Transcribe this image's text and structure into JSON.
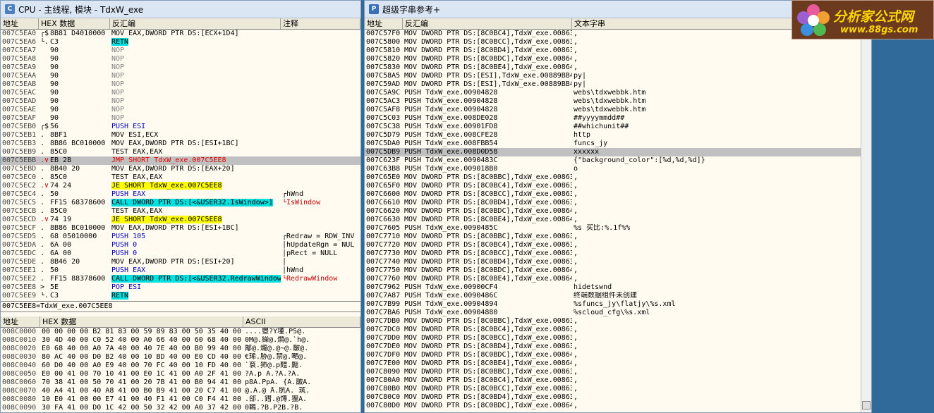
{
  "cpu_window": {
    "title": "CPU - 主线程, 模块 - TdxW_exe",
    "headers": {
      "addr": "地址",
      "hex": "HEX 数据",
      "asm": "反汇编",
      "cmt": "注释"
    },
    "rows": [
      {
        "a": "007C5EA0",
        "m": "┌$",
        "h": "8B81 D4010000",
        "i": "MOV EAX,DWORD PTR DS:[ECX+1D4]",
        "c": "",
        "k": ""
      },
      {
        "a": "007C5EA6",
        "m": "└.",
        "h": "C3",
        "i": "RETN",
        "c": "",
        "k": "ret"
      },
      {
        "a": "007C5EA7",
        "m": "",
        "h": "90",
        "i": "NOP",
        "c": "",
        "k": "nop"
      },
      {
        "a": "007C5EA8",
        "m": "",
        "h": "90",
        "i": "NOP",
        "c": "",
        "k": "nop"
      },
      {
        "a": "007C5EA9",
        "m": "",
        "h": "90",
        "i": "NOP",
        "c": "",
        "k": "nop"
      },
      {
        "a": "007C5EAA",
        "m": "",
        "h": "90",
        "i": "NOP",
        "c": "",
        "k": "nop"
      },
      {
        "a": "007C5EAB",
        "m": "",
        "h": "90",
        "i": "NOP",
        "c": "",
        "k": "nop"
      },
      {
        "a": "007C5EAC",
        "m": "",
        "h": "90",
        "i": "NOP",
        "c": "",
        "k": "nop"
      },
      {
        "a": "007C5EAD",
        "m": "",
        "h": "90",
        "i": "NOP",
        "c": "",
        "k": "nop"
      },
      {
        "a": "007C5EAE",
        "m": "",
        "h": "90",
        "i": "NOP",
        "c": "",
        "k": "nop"
      },
      {
        "a": "007C5EAF",
        "m": "",
        "h": "90",
        "i": "NOP",
        "c": "",
        "k": "nop"
      },
      {
        "a": "007C5EB0",
        "m": "┌$",
        "h": "56",
        "i": "PUSH ESI",
        "c": "",
        "k": "push"
      },
      {
        "a": "007C5EB1",
        "m": ".",
        "h": "8BF1",
        "i": "MOV ESI,ECX",
        "c": "",
        "k": ""
      },
      {
        "a": "007C5EB3",
        "m": ".",
        "h": "8B86 BC010000",
        "i": "MOV EAX,DWORD PTR DS:[ESI+1BC]",
        "c": "",
        "k": ""
      },
      {
        "a": "007C5EB9",
        "m": ".",
        "h": "85C0",
        "i": "TEST EAX,EAX",
        "c": "",
        "k": ""
      },
      {
        "a": "007C5EBB",
        "m": ".∨",
        "h": "EB 2B",
        "i": "JMP SHORT TdxW_exe.007C5EE8",
        "c": "",
        "k": "jmp",
        "sel": true
      },
      {
        "a": "007C5EBD",
        "m": ".",
        "h": "8B40 20",
        "i": "MOV EAX,DWORD PTR DS:[EAX+20]",
        "c": "",
        "k": ""
      },
      {
        "a": "007C5EC0",
        "m": ".",
        "h": "85C0",
        "i": "TEST EAX,EAX",
        "c": "",
        "k": ""
      },
      {
        "a": "007C5EC2",
        "m": ".∨",
        "h": "74 24",
        "i": "JE SHORT TdxW_exe.007C5EE8",
        "c": "",
        "k": "je"
      },
      {
        "a": "007C5EC4",
        "m": ".",
        "h": "50",
        "i": "PUSH EAX",
        "c": "┌hWnd",
        "k": "push"
      },
      {
        "a": "007C5EC5",
        "m": ".",
        "h": "FF15 68378600",
        "i": "CALL DWORD PTR DS:[<&USER32.IsWindow>]",
        "c": "└IsWindow",
        "k": "call",
        "cr": true
      },
      {
        "a": "007C5ECB",
        "m": ".",
        "h": "85C0",
        "i": "TEST EAX,EAX",
        "c": "",
        "k": ""
      },
      {
        "a": "007C5ECD",
        "m": ".∨",
        "h": "74 19",
        "i": "JE SHORT TdxW_exe.007C5EE8",
        "c": "",
        "k": "je"
      },
      {
        "a": "007C5ECF",
        "m": ".",
        "h": "8B86 BC010000",
        "i": "MOV EAX,DWORD PTR DS:[ESI+1BC]",
        "c": "",
        "k": ""
      },
      {
        "a": "007C5ED5",
        "m": ".",
        "h": "68 05010000",
        "i": "PUSH 105",
        "c": "┌Redraw = RDW_INV",
        "k": "push"
      },
      {
        "a": "007C5EDA",
        "m": ".",
        "h": "6A 00",
        "i": "PUSH 0",
        "c": "│hUpdateRgn = NUL",
        "k": "push"
      },
      {
        "a": "007C5EDC",
        "m": ".",
        "h": "6A 00",
        "i": "PUSH 0",
        "c": "│pRect = NULL",
        "k": "push"
      },
      {
        "a": "007C5EDE",
        "m": ".",
        "h": "8B46 20",
        "i": "MOV EAX,DWORD PTR DS:[ESI+20]",
        "c": "│",
        "k": ""
      },
      {
        "a": "007C5EE1",
        "m": ".",
        "h": "50",
        "i": "PUSH EAX",
        "c": "│hWnd",
        "k": "push"
      },
      {
        "a": "007C5EE2",
        "m": ".",
        "h": "FF15 88378600",
        "i": "CALL DWORD PTR DS:[<&USER32.RedrawWindow>]",
        "c": "└RedrawWindow",
        "k": "call",
        "cr": true
      },
      {
        "a": "007C5EE8",
        "m": "> 5E",
        "h": "5E",
        "i": "POP ESI",
        "c": "",
        "k": "push"
      },
      {
        "a": "007C5EE9",
        "m": "└.",
        "h": "C3",
        "i": "RETN",
        "c": "",
        "k": "ret"
      }
    ],
    "info": "007C5EE8=TdxW_exe.007C5EE8",
    "dump_headers": {
      "addr": "地址",
      "hex": "HEX 数据",
      "ascii": "ASCII"
    },
    "dump": [
      {
        "a": "008C0000",
        "h": "00 00 00 00 B2 81 83 00 59 89 83 00 50 35 40 00",
        "t": "....瞾?Y墐.P5@."
      },
      {
        "a": "008C0010",
        "h": "30 4D 40 00 C0 52 40 00 A0 66 40 00 60 68 40 00",
        "t": "0M@.繰@.燜@.`h@."
      },
      {
        "a": "008C0020",
        "h": "E0 68 40 00 A0 7A 40 00 40 7E 40 00 B0 99 40 00",
        "t": "鄅@.爖@.@~@.皺@."
      },
      {
        "a": "008C0030",
        "h": "80 AC 40 00 D0 B2 40 00 10 BD 40 00 E0 CD 40 00",
        "t": "€琋.胁@.禁@.嗮@."
      },
      {
        "a": "008C0040",
        "h": "60 D0 40 00 A0 E9 40 00 70 FC 40 00 10 FD 40 00",
        "t": "`袬.犻@.p麷.齆."
      },
      {
        "a": "008C0050",
        "h": "E0 00 41 00 70 10 41 00 E0 1C 41 00 A0 2F 41 00",
        "t": "?A.p A.?A.?A."
      },
      {
        "a": "008C0060",
        "h": "70 38 41 00 50 70 41 00 20 7B 41 00 B0 94 41 00",
        "t": "p8A.PpA. {A.皵A."
      },
      {
        "a": "008C0070",
        "h": "40 A4 41 00 40 A8 41 00 B0 B9 41 00 20 C7 41 00",
        "t": "@.A.@ ̄A.肮A. 茿."
      },
      {
        "a": "008C0080",
        "h": "10 E0 41 00 00 E7 41 00 40 F1 41 00 C0 F4 41 00",
        "t": ".郃..鏏.@馎.狸A."
      },
      {
        "a": "008C0090",
        "h": "30 FA 41 00 D0 1C 42 00 50 32 42 00 A0 37 42 00",
        "t": "0鶤.?B.P2B.?B."
      }
    ]
  },
  "strings_window": {
    "title": "超级字串参考+",
    "headers": {
      "addr": "地址",
      "asm": "反汇编",
      "txt": "文本字串"
    },
    "rows": [
      {
        "a": "007C57F0",
        "i": "MOV DWORD PTR DS:[8C0BC4],TdxW_exe.00863",
        "t": ","
      },
      {
        "a": "007C5800",
        "i": "MOV DWORD PTR DS:[8C0BCC],TdxW_exe.00863",
        "t": ","
      },
      {
        "a": "007C5810",
        "i": "MOV DWORD PTR DS:[8C0BD4],TdxW_exe.00863",
        "t": ","
      },
      {
        "a": "007C5820",
        "i": "MOV DWORD PTR DS:[8C0BDC],TdxW_exe.00864",
        "t": ","
      },
      {
        "a": "007C5830",
        "i": "MOV DWORD PTR DS:[8C0BE4],TdxW_exe.00864",
        "t": ","
      },
      {
        "a": "007C58A5",
        "i": "MOV DWORD PTR DS:[ESI],TdxW_exe.00889BB4",
        "t": "py|"
      },
      {
        "a": "007C59AD",
        "i": "MOV DWORD PTR DS:[ESI],TdxW_exe.00889BB4",
        "t": "py|"
      },
      {
        "a": "007C5A9C",
        "i": "PUSH TdxW_exe.00904828",
        "t": "webs\\tdxwebbk.htm"
      },
      {
        "a": "007C5AC3",
        "i": "PUSH TdxW_exe.00904828",
        "t": "webs\\tdxwebbk.htm"
      },
      {
        "a": "007C5AF8",
        "i": "PUSH TdxW_exe.00904828",
        "t": "webs\\tdxwebbk.htm"
      },
      {
        "a": "007C5C03",
        "i": "PUSH TdxW_exe.008DE028",
        "t": "##yyyymmdd##"
      },
      {
        "a": "007C5C38",
        "i": "PUSH TdxW_exe.00901FD8",
        "t": "##whichunit##"
      },
      {
        "a": "007C5D79",
        "i": "PUSH TdxW_exe.008CFE28",
        "t": "http"
      },
      {
        "a": "007C5DA0",
        "i": "PUSH TdxW_exe.008FBB54",
        "t": "funcs_jy"
      },
      {
        "a": "007C5DB9",
        "i": "PUSH TdxW_exe.008D0D58",
        "t": "xxxxxx",
        "sel": true
      },
      {
        "a": "007C623F",
        "i": "PUSH TdxW_exe.0090483C",
        "t": "{\"background_color\":[%d,%d,%d]}"
      },
      {
        "a": "007C63B8",
        "i": "PUSH TdxW_exe.009018B0",
        "t": "o"
      },
      {
        "a": "007C65E0",
        "i": "MOV DWORD PTR DS:[8C0BBC],TdxW_exe.00863",
        "t": ","
      },
      {
        "a": "007C65F0",
        "i": "MOV DWORD PTR DS:[8C0BC4],TdxW_exe.00863",
        "t": ","
      },
      {
        "a": "007C6600",
        "i": "MOV DWORD PTR DS:[8C0BCC],TdxW_exe.00863",
        "t": ","
      },
      {
        "a": "007C6610",
        "i": "MOV DWORD PTR DS:[8C0BD4],TdxW_exe.00863",
        "t": ","
      },
      {
        "a": "007C6620",
        "i": "MOV DWORD PTR DS:[8C0BDC],TdxW_exe.00864",
        "t": ","
      },
      {
        "a": "007C6630",
        "i": "MOV DWORD PTR DS:[8C0BE4],TdxW_exe.00864",
        "t": ","
      },
      {
        "a": "007C7605",
        "i": "PUSH TdxW_exe.0090485C",
        "t": "%s 买比:%.1f%%"
      },
      {
        "a": "007C7710",
        "i": "MOV DWORD PTR DS:[8C0BBC],TdxW_exe.00863",
        "t": ","
      },
      {
        "a": "007C7720",
        "i": "MOV DWORD PTR DS:[8C0BC4],TdxW_exe.00863",
        "t": ","
      },
      {
        "a": "007C7730",
        "i": "MOV DWORD PTR DS:[8C0BCC],TdxW_exe.00863",
        "t": ","
      },
      {
        "a": "007C7740",
        "i": "MOV DWORD PTR DS:[8C0BD4],TdxW_exe.00863",
        "t": ","
      },
      {
        "a": "007C7750",
        "i": "MOV DWORD PTR DS:[8C0BDC],TdxW_exe.00864",
        "t": ","
      },
      {
        "a": "007C7760",
        "i": "MOV DWORD PTR DS:[8C0BE4],TdxW_exe.00864",
        "t": ","
      },
      {
        "a": "007C7962",
        "i": "PUSH TdxW_exe.00900CF4",
        "t": "hidetswnd"
      },
      {
        "a": "007C7A87",
        "i": "PUSH TdxW_exe.0090486C",
        "t": "终端数据组件未创建"
      },
      {
        "a": "007C7B99",
        "i": "PUSH TdxW_exe.00904894",
        "t": "%sfuncs_jy\\flatjy\\%s.xml"
      },
      {
        "a": "007C7BA6",
        "i": "PUSH TdxW_exe.00904880",
        "t": "%scloud_cfg\\%s.xml"
      },
      {
        "a": "007C7DB0",
        "i": "MOV DWORD PTR DS:[8C0BBC],TdxW_exe.00863",
        "t": ","
      },
      {
        "a": "007C7DC0",
        "i": "MOV DWORD PTR DS:[8C0BC4],TdxW_exe.00863",
        "t": ","
      },
      {
        "a": "007C7DD0",
        "i": "MOV DWORD PTR DS:[8C0BCC],TdxW_exe.00863",
        "t": ","
      },
      {
        "a": "007C7DE0",
        "i": "MOV DWORD PTR DS:[8C0BD4],TdxW_exe.00863",
        "t": ","
      },
      {
        "a": "007C7DF0",
        "i": "MOV DWORD PTR DS:[8C0BDC],TdxW_exe.00864",
        "t": ","
      },
      {
        "a": "007C7E00",
        "i": "MOV DWORD PTR DS:[8C0BE4],TdxW_exe.00864",
        "t": ","
      },
      {
        "a": "007C8090",
        "i": "MOV DWORD PTR DS:[8C0BBC],TdxW_exe.00863",
        "t": ","
      },
      {
        "a": "007C80A0",
        "i": "MOV DWORD PTR DS:[8C0BC4],TdxW_exe.00863",
        "t": ","
      },
      {
        "a": "007C80B0",
        "i": "MOV DWORD PTR DS:[8C0BCC],TdxW_exe.00863",
        "t": ","
      },
      {
        "a": "007C80C0",
        "i": "MOV DWORD PTR DS:[8C0BD4],TdxW_exe.00863",
        "t": ","
      },
      {
        "a": "007C80D0",
        "i": "MOV DWORD PTR DS:[8C0BDC],TdxW_exe.00864",
        "t": ","
      }
    ]
  },
  "logo": {
    "title": "分析家公式网",
    "url": "www.88gs.com"
  }
}
